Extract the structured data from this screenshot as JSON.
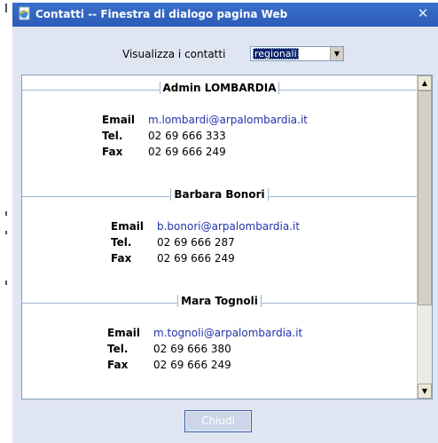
{
  "window": {
    "title": "Contatti -- Finestra di dialogo pagina Web",
    "close_glyph": "✕"
  },
  "filter": {
    "label": "Visualizza i contatti",
    "selected": "regionali",
    "arrow": "▼"
  },
  "labels": {
    "email": "Email",
    "tel": "Tel.",
    "fax": "Fax"
  },
  "contacts": [
    {
      "name": "Admin LOMBARDIA",
      "email": "m.lombardi@arpalombardia.it",
      "tel": "02 69 666 333",
      "fax": "02 69 666 249"
    },
    {
      "name": "Barbara Bonori",
      "email": "b.bonori@arpalombardia.it",
      "tel": "02 69 666 287",
      "fax": "02 69 666 249"
    },
    {
      "name": "Mara Tognoli",
      "email": "m.tognoli@arpalombardia.it",
      "tel": "02 69 666 380",
      "fax": "02 69 666 249"
    }
  ],
  "scrollbar": {
    "up": "▲",
    "down": "▼"
  },
  "footer": {
    "close_label": "Chiudi"
  },
  "colors": {
    "titlebar": "#2b5cb8",
    "link": "#2233aa",
    "dialog_bg": "#dfe6f2"
  }
}
